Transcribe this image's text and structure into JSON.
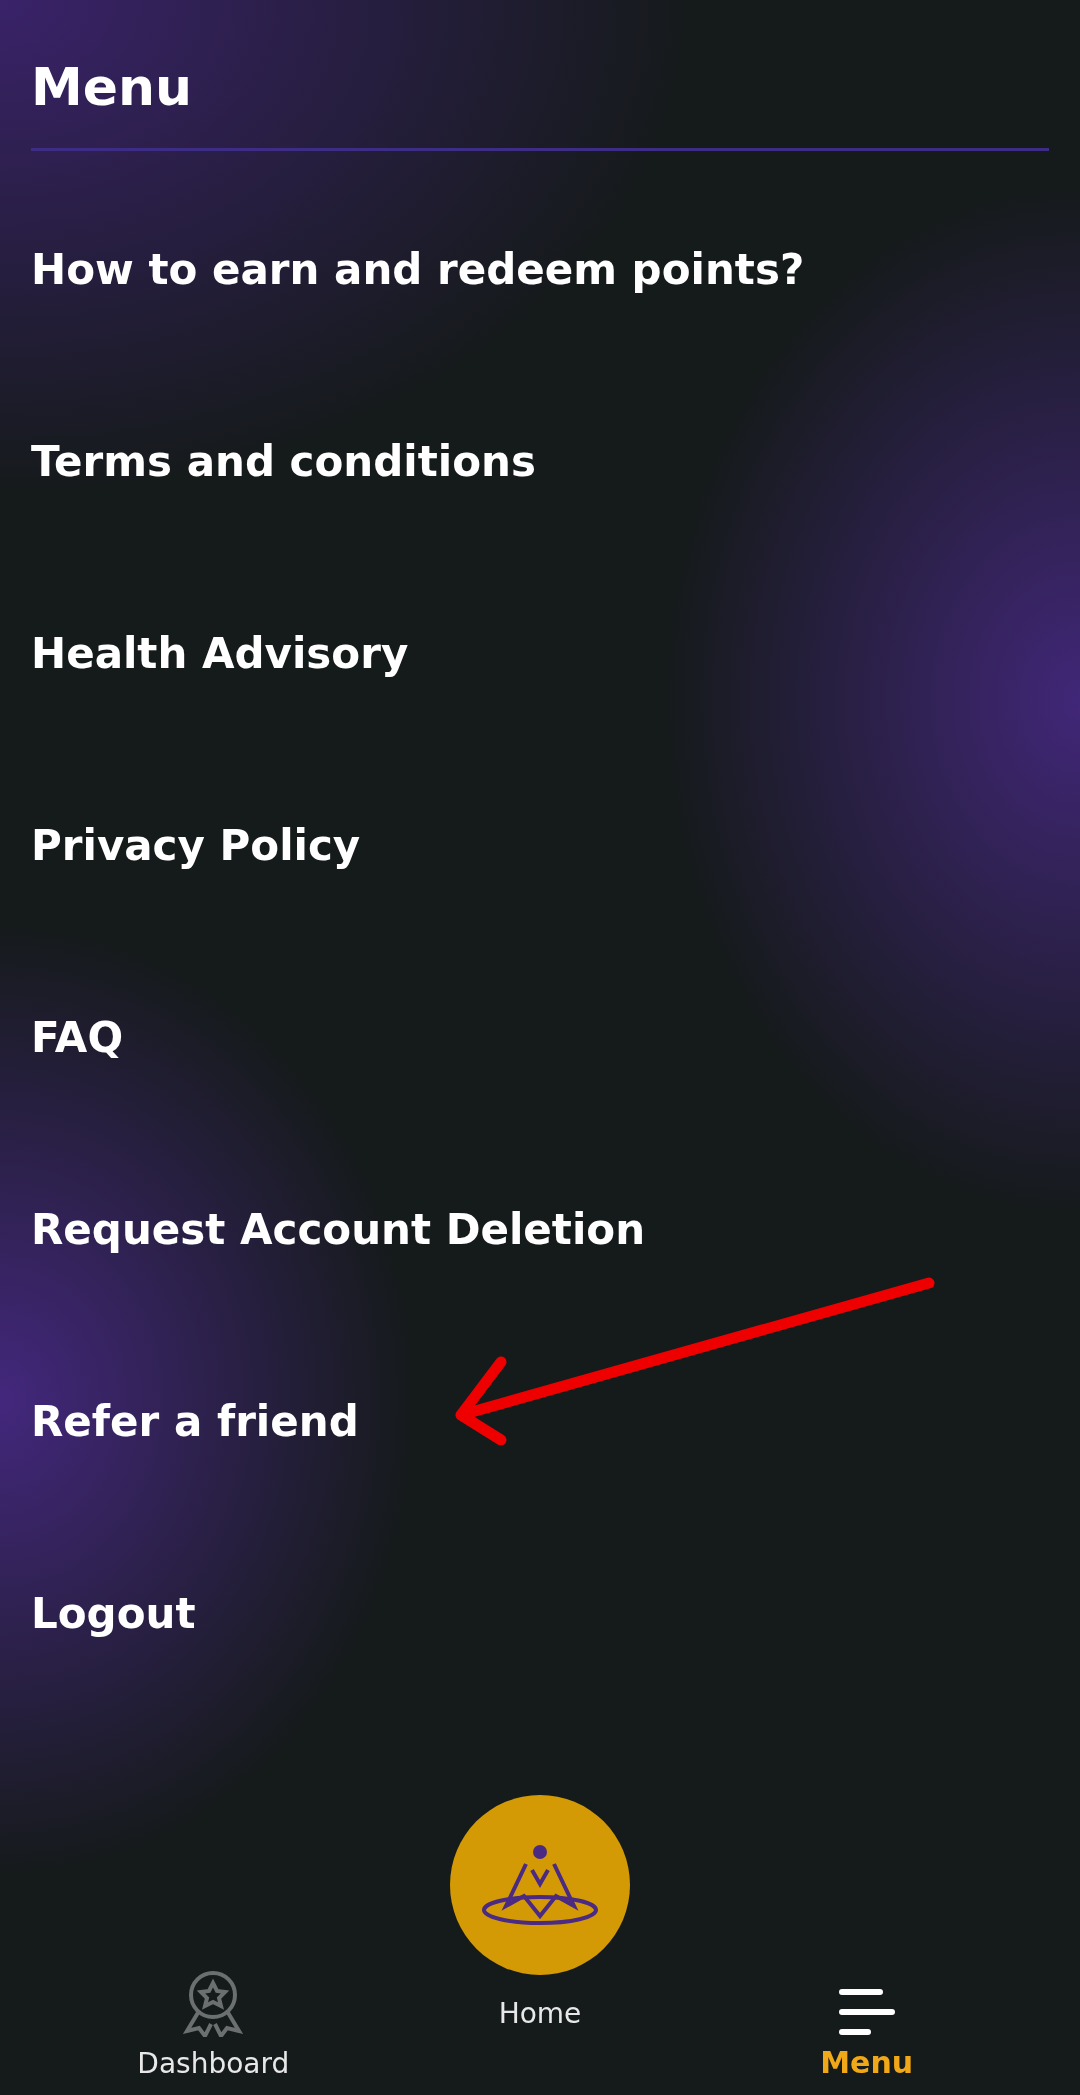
{
  "header": {
    "title": "Menu"
  },
  "items": [
    {
      "label": "How to earn and redeem points?",
      "annotated": false
    },
    {
      "label": "Terms and conditions",
      "annotated": false
    },
    {
      "label": "Health Advisory",
      "annotated": false
    },
    {
      "label": "Privacy Policy",
      "annotated": false
    },
    {
      "label": "FAQ",
      "annotated": false
    },
    {
      "label": "Request Account Deletion",
      "annotated": false
    },
    {
      "label": "Refer a friend",
      "annotated": true
    },
    {
      "label": "Logout",
      "annotated": false
    }
  ],
  "bottom_nav": [
    {
      "kind": "dashboard",
      "label": "Dashboard",
      "selected": false
    },
    {
      "kind": "home",
      "label": "Home",
      "selected": false
    },
    {
      "kind": "menu",
      "label": "Menu",
      "selected": true
    }
  ]
}
